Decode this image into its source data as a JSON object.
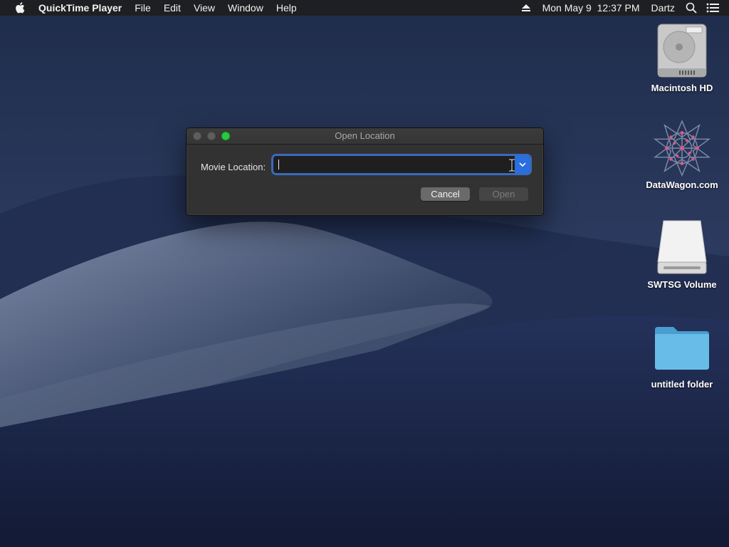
{
  "menubar": {
    "app_name": "QuickTime Player",
    "menus": [
      "File",
      "Edit",
      "View",
      "Window",
      "Help"
    ],
    "datetime": "Mon May 9  12:37 PM",
    "user": "Dartz"
  },
  "dialog": {
    "title": "Open Location",
    "field_label": "Movie Location:",
    "field_value": "",
    "cancel_label": "Cancel",
    "open_label": "Open"
  },
  "desktop": {
    "icons": [
      {
        "label": "Macintosh HD",
        "icon": "hard-drive-icon"
      },
      {
        "label": "DataWagon.com",
        "icon": "network-share-icon"
      },
      {
        "label": "SWTSG Volume",
        "icon": "external-drive-icon"
      },
      {
        "label": "untitled folder",
        "icon": "folder-icon"
      }
    ]
  },
  "colors": {
    "menubar_bg": "#1e1f23",
    "dialog_bg": "#323232",
    "focus_ring": "#3a76d7",
    "zoom_button": "#28c840",
    "folder": "#5fb6e5"
  }
}
